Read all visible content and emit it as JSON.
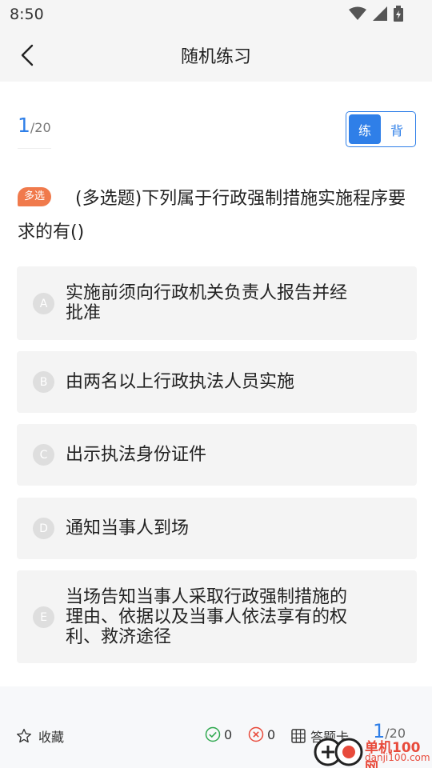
{
  "status": {
    "time": "8:50"
  },
  "nav": {
    "title": "随机练习"
  },
  "counter": {
    "current": "1",
    "total": "/20"
  },
  "mode": {
    "practice": "练",
    "recite": "背"
  },
  "question": {
    "badge": "多选",
    "text": "(多选题)下列属于行政强制措施实施程序要求的有()"
  },
  "options": [
    {
      "letter": "A",
      "line1": "实施前须向行政机关负责人报告并经",
      "line2": "批准",
      "line3": ""
    },
    {
      "letter": "B",
      "line1": "由两名以上行政执法人员实施",
      "line2": "",
      "line3": ""
    },
    {
      "letter": "C",
      "line1": "出示执法身份证件",
      "line2": "",
      "line3": ""
    },
    {
      "letter": "D",
      "line1": "通知当事人到场",
      "line2": "",
      "line3": ""
    },
    {
      "letter": "E",
      "line1": "当场告知当事人采取行政强制措施的",
      "line2": "理由、依据以及当事人依法享有的权",
      "line3": "利、救济途径"
    }
  ],
  "bottom": {
    "favorite": "收藏",
    "correct_count": "0",
    "wrong_count": "0",
    "answer_card": "答题卡",
    "current": "1",
    "total": "/20"
  },
  "watermark": {
    "line1": "单机100网",
    "line2": "danji100.com"
  },
  "colors": {
    "accent": "#2f7fe8",
    "badge": "#f07a4c",
    "correct": "#2fa84f",
    "wrong": "#e84a3b"
  }
}
